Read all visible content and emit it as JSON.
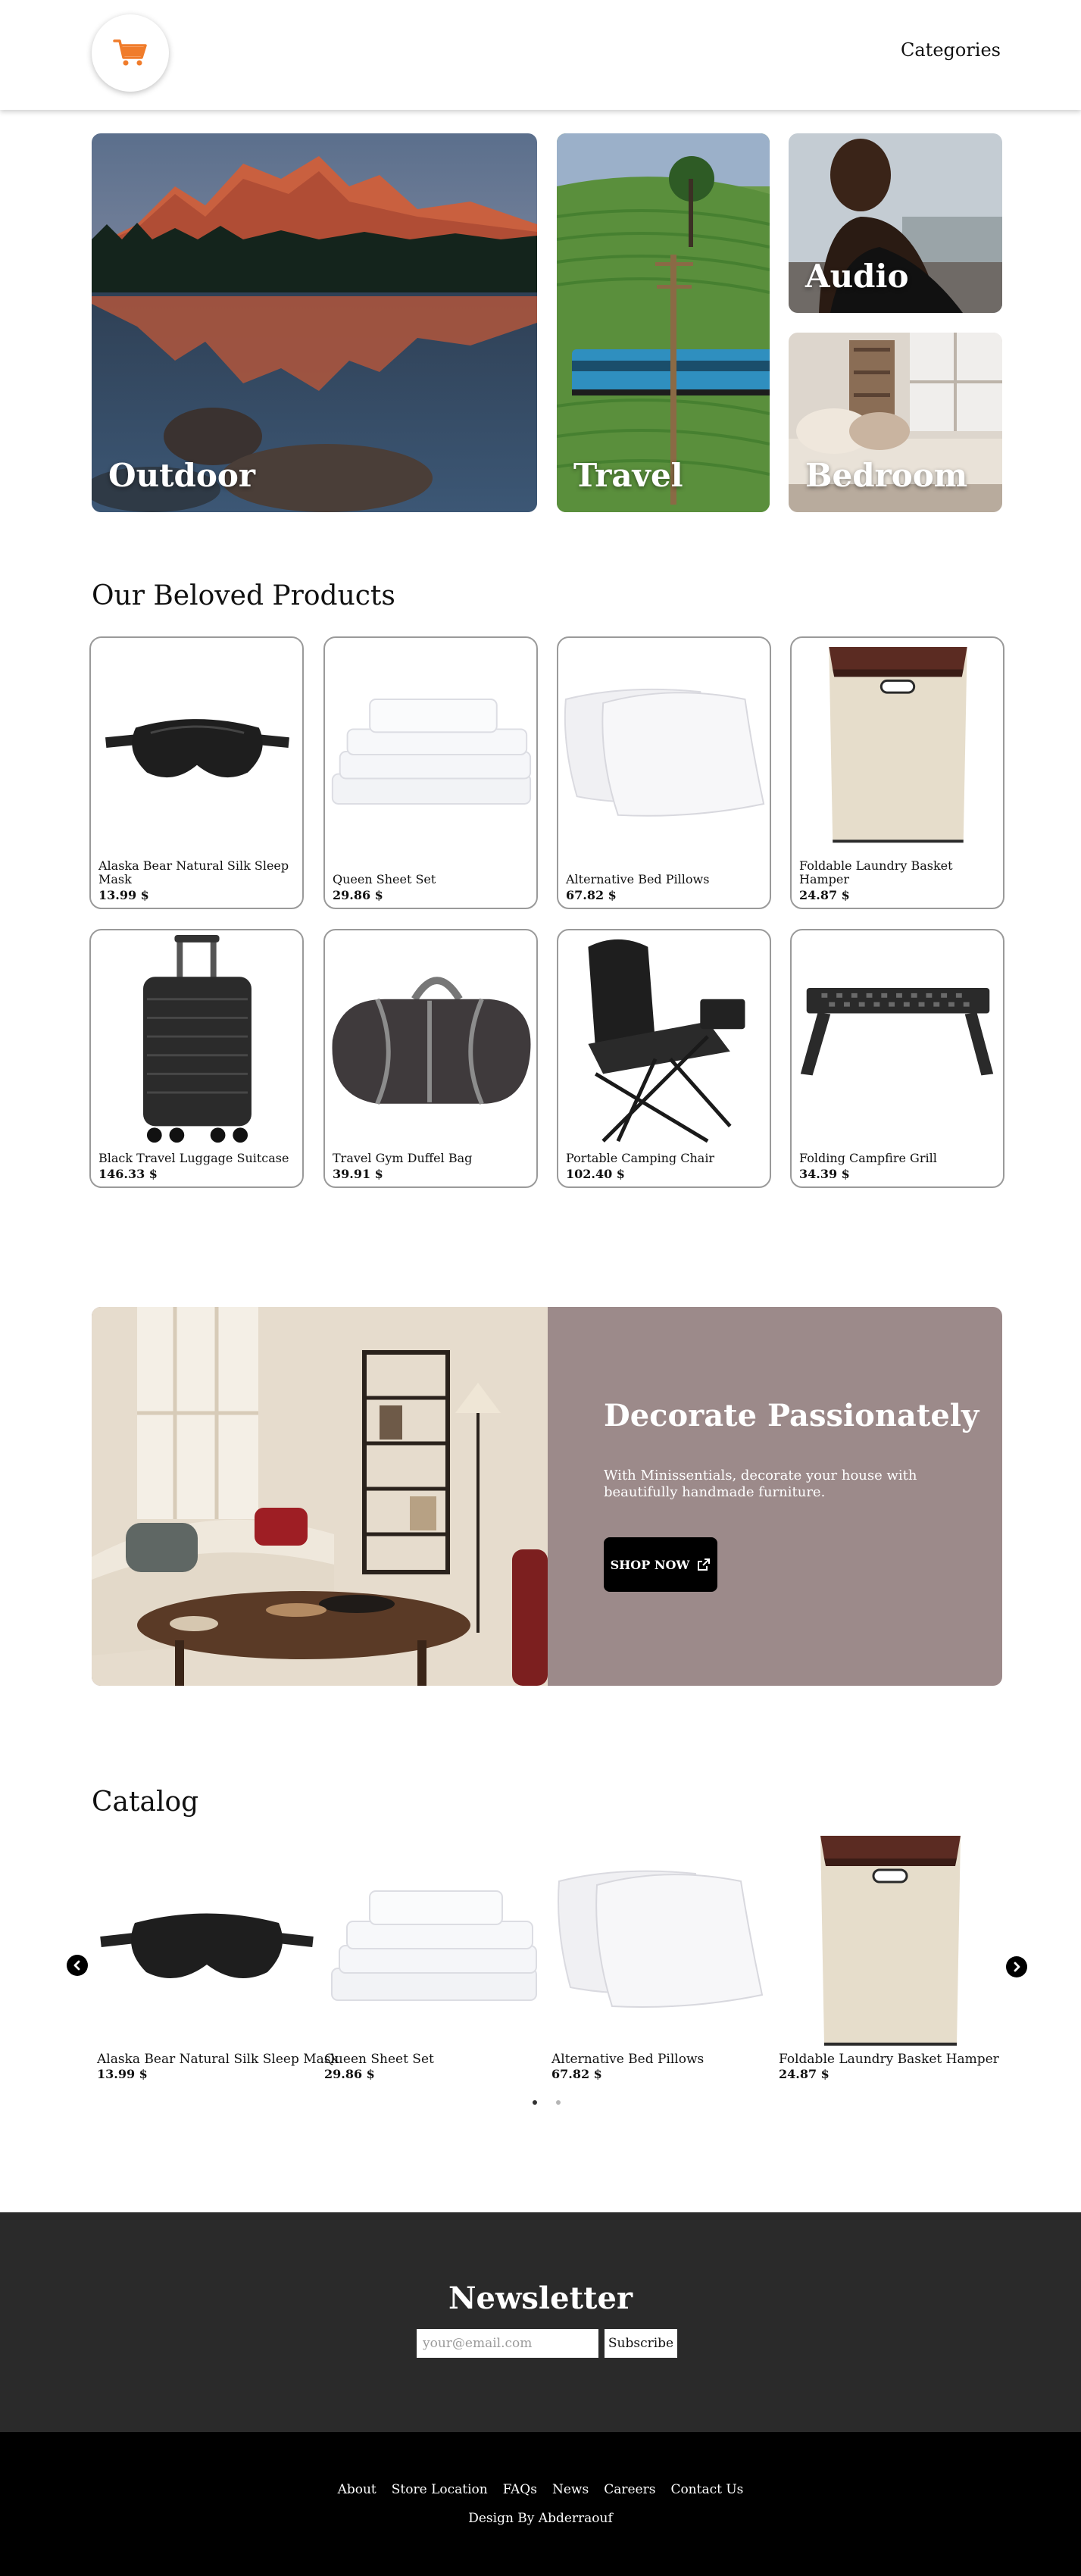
{
  "header": {
    "logo_icon": "shopping-cart-icon",
    "brand_color": "#f07c2b",
    "nav_label": "Categories"
  },
  "hero": {
    "tiles": [
      {
        "label": "Outdoor"
      },
      {
        "label": "Travel"
      },
      {
        "label": "Audio"
      },
      {
        "label": "Bedroom"
      }
    ]
  },
  "products": {
    "title": "Our Beloved Products",
    "items": [
      {
        "name": "Alaska Bear Natural Silk Sleep Mask",
        "price": "13.99 $"
      },
      {
        "name": "Queen Sheet Set",
        "price": "29.86 $"
      },
      {
        "name": "Alternative Bed Pillows",
        "price": "67.82 $"
      },
      {
        "name": "Foldable Laundry Basket Hamper",
        "price": "24.87 $"
      },
      {
        "name": "Black Travel Luggage Suitcase",
        "price": "146.33 $"
      },
      {
        "name": "Travel Gym Duffel Bag",
        "price": "39.91 $"
      },
      {
        "name": "Portable Camping Chair",
        "price": "102.40 $"
      },
      {
        "name": "Folding Campfire Grill",
        "price": "34.39 $"
      }
    ]
  },
  "promo": {
    "title": "Decorate Passionately",
    "text": "With Minissentials, decorate your house with beautifully handmade furniture.",
    "button_label": "SHOP NOW",
    "button_icon": "external-link-icon",
    "panel_color": "#9c8a8a"
  },
  "catalog": {
    "title": "Catalog",
    "items": [
      {
        "name": "Alaska Bear Natural Silk Sleep Mask",
        "price": "13.99 $"
      },
      {
        "name": "Queen Sheet Set",
        "price": "29.86 $"
      },
      {
        "name": "Alternative Bed Pillows",
        "price": "67.82 $"
      },
      {
        "name": "Foldable Laundry Basket Hamper",
        "price": "24.87 $"
      }
    ],
    "prev_icon": "chevron-left-icon",
    "next_icon": "chevron-right-icon",
    "active_page": 1,
    "page_count": 2
  },
  "newsletter": {
    "title": "Newsletter",
    "placeholder": "your@email.com",
    "button_label": "Subscribe"
  },
  "footer": {
    "links": [
      "About",
      "Store Location",
      "FAQs",
      "News",
      "Careers",
      "Contact Us"
    ],
    "credit": "Design By Abderraouf"
  }
}
